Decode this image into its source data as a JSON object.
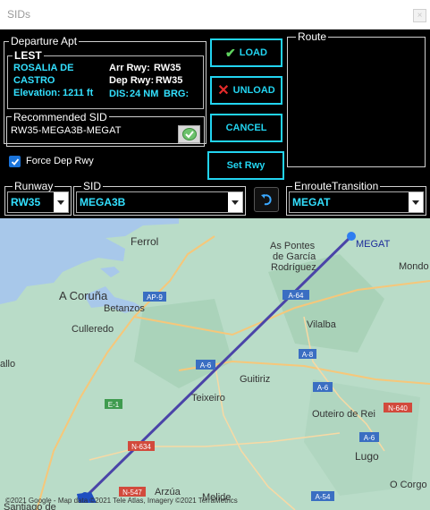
{
  "window": {
    "title": "SIDs",
    "close_glyph": "×"
  },
  "departure": {
    "group_label": "Departure Apt",
    "code": "LEST",
    "name_line1": "ROSALIA DE",
    "name_line2": "CASTRO",
    "elevation_label": "Elevation:",
    "elevation_value": "1211 ft",
    "arr_rwy_label": "Arr Rwy:",
    "arr_rwy_value": "RW35",
    "dep_rwy_label": "Dep Rwy:",
    "dep_rwy_value": "RW35",
    "dis_label": "DIS:",
    "dis_value": "24 NM",
    "brg_label": "BRG:",
    "brg_value": ""
  },
  "recommended": {
    "group_label": "Recommended SID",
    "value": "RW35-MEGA3B-MEGAT"
  },
  "force_dep_rwy": {
    "label": "Force Dep Rwy",
    "checked": true
  },
  "buttons": {
    "load": "LOAD",
    "unload": "UNLOAD",
    "cancel": "CANCEL",
    "set_rwy": "Set Rwy"
  },
  "route": {
    "group_label": "Route"
  },
  "runway": {
    "group_label": "Runway",
    "selected": "RW35"
  },
  "sid": {
    "group_label": "SID",
    "selected": "MEGA3B"
  },
  "enroute": {
    "group_label": "EnrouteTransition",
    "selected": "MEGAT"
  },
  "map": {
    "waypoint": "MEGAT",
    "attribution": "©2021 Google - Map data ©2021 Tele Atlas, Imagery ©2021 TerraMetrics",
    "places": {
      "ferrol": "Ferrol",
      "as_pontes": "As Pontes",
      "de_garcia": "de García",
      "rodriguez": "Rodríguez",
      "mondo": "Mondo",
      "a_coruna": "A Coruña",
      "culleredo": "Culleredo",
      "betanzos": "Betanzos",
      "vilalba": "Vilalba",
      "allo": "allo",
      "guitiriz": "Guitiriz",
      "teixeiro": "Teixeiro",
      "outeiro": "Outeiro de Rei",
      "lugo": "Lugo",
      "o_corgo": "O Corgo",
      "arzua": "Arzúa",
      "melide": "Melide",
      "santiago": "Santiago de"
    },
    "roads": {
      "ap9": "AP-9",
      "a64": "A-64",
      "a8": "A-8",
      "a6_1": "A-6",
      "a6_2": "A-6",
      "a6_3": "A-6",
      "e1": "E-1",
      "n634": "N-634",
      "n640": "N-640",
      "n547": "N-547",
      "a54": "A-54"
    },
    "colors": {
      "land": "#b9dcc8",
      "sea": "#a8c8ea",
      "route": "#4a44a8",
      "road": "#f6c77a"
    }
  }
}
